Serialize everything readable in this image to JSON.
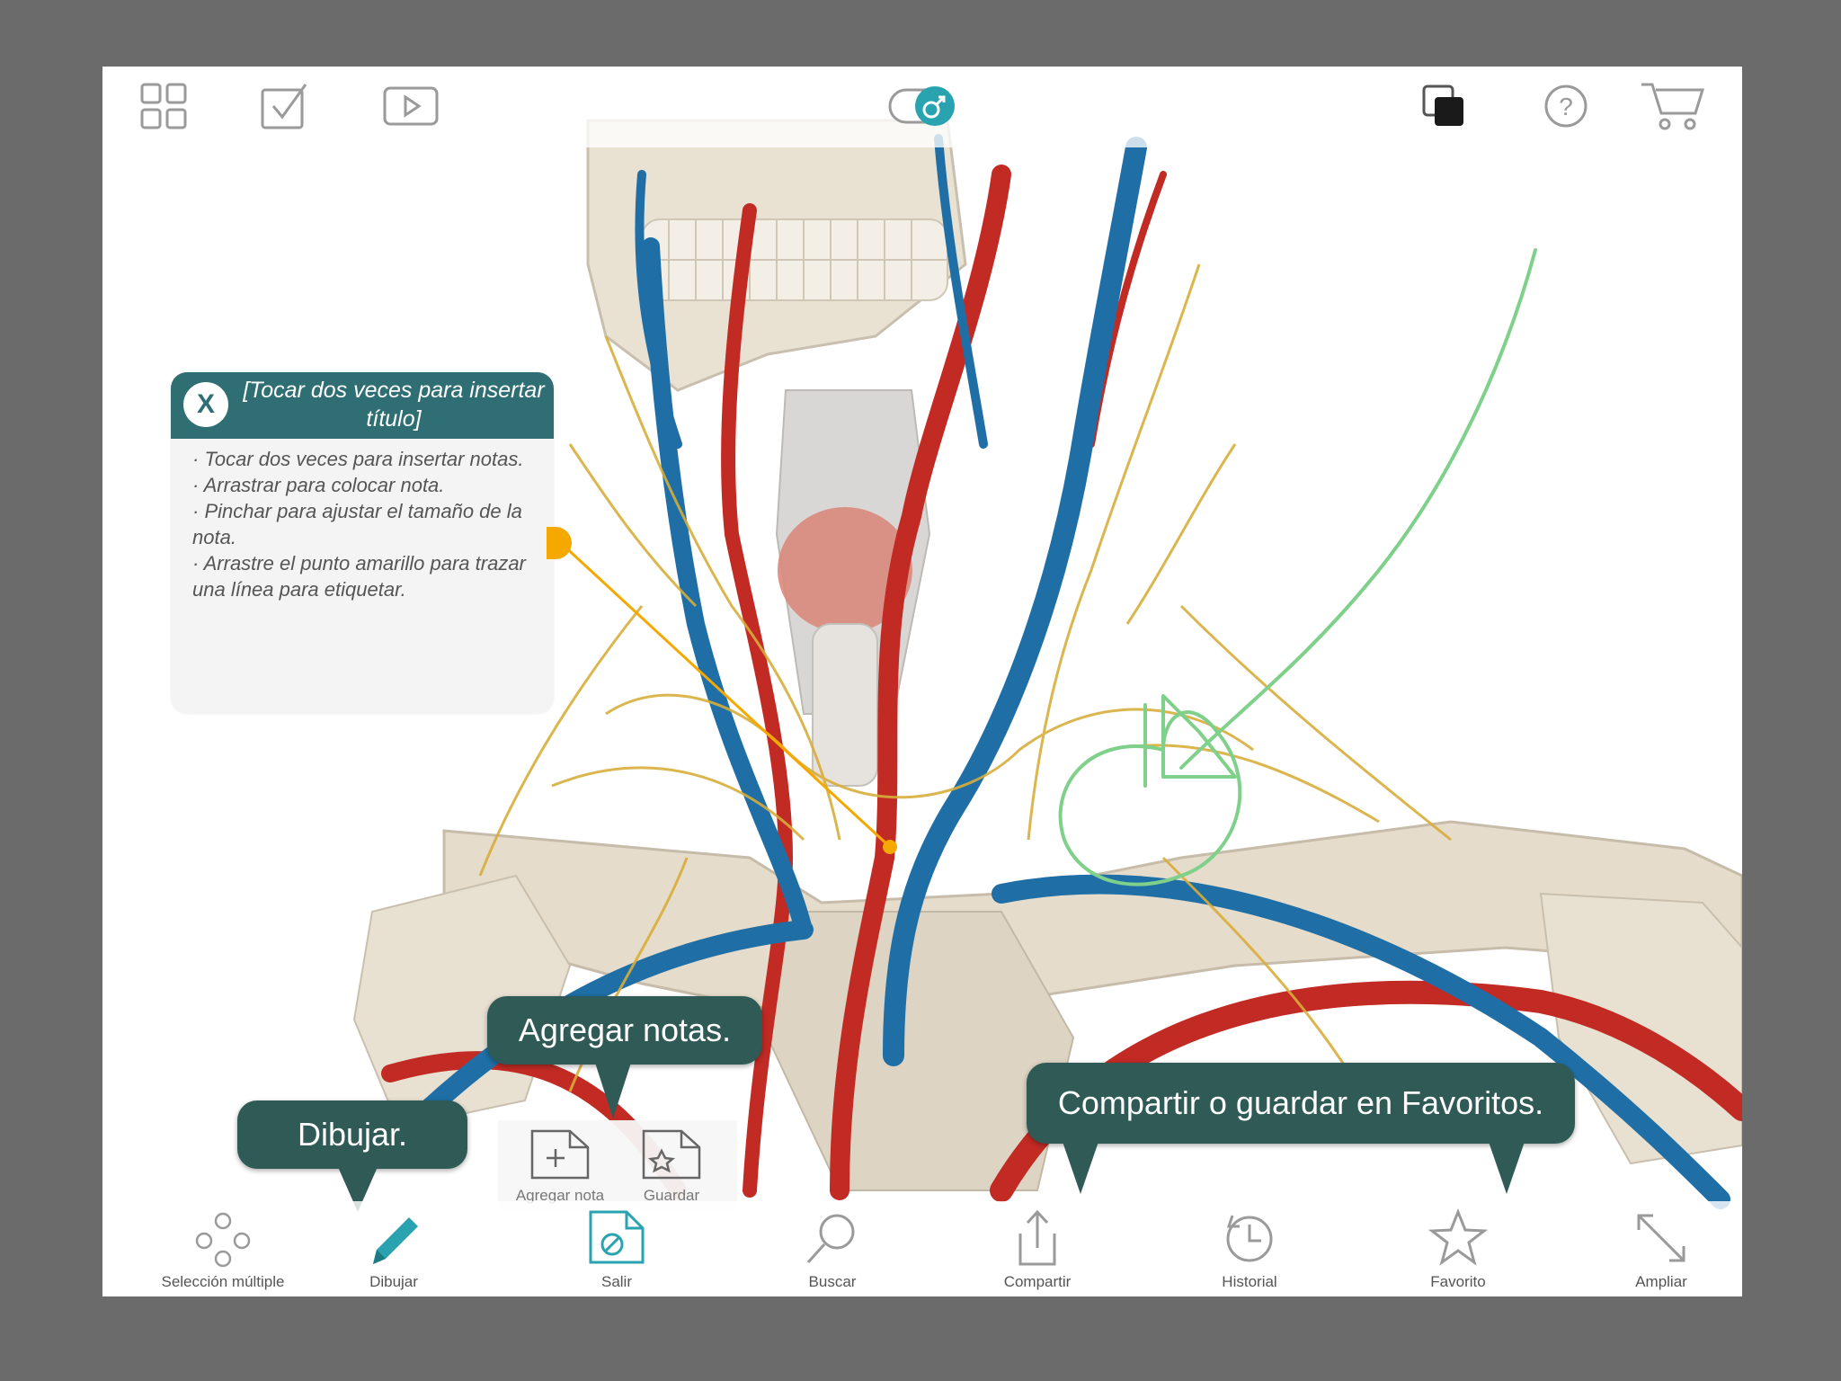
{
  "topbar": {
    "icons": [
      "grid-icon",
      "checkbox-icon",
      "video-icon",
      "gender-toggle-icon",
      "layers-icon",
      "help-icon",
      "cart-icon"
    ]
  },
  "note": {
    "close_label": "X",
    "title": "[Tocar dos veces para insertar título]",
    "lines": [
      "· Tocar dos veces para insertar notas.",
      "· Arrastrar para colocar nota.",
      "· Pinchar para ajustar el tamaño de la nota.",
      "· Arrastre el punto amarillo para trazar una línea para etiquetar."
    ]
  },
  "callouts": {
    "draw": "Dibujar.",
    "add_notes": "Agregar notas.",
    "share": "Compartir o guardar en Favoritos."
  },
  "note_popup": {
    "add_note": "Agregar nota",
    "save": "Guardar"
  },
  "bottombar": {
    "multi_select": "Selección múltiple",
    "draw": "Dibujar",
    "exit": "Salir",
    "search": "Buscar",
    "share": "Compartir",
    "history": "Historial",
    "favorite": "Favorito",
    "expand": "Ampliar"
  },
  "colors": {
    "teal": "#2f6f73",
    "callout": "#2f5a55",
    "accent_active": "#2aa3b0",
    "annotation_green": "#7fd08a",
    "label_line": "#f5a800",
    "background": "#6b6b6b"
  }
}
